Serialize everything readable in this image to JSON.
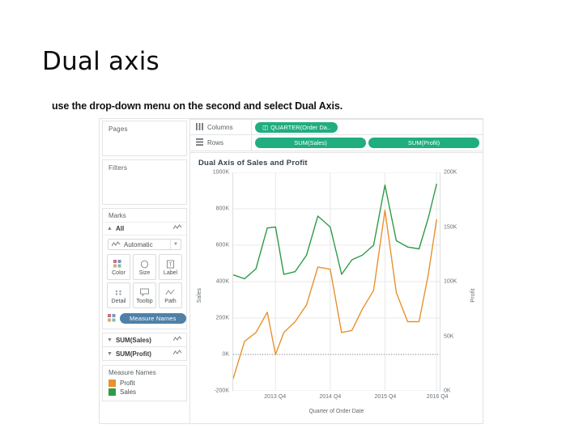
{
  "slide": {
    "title": "Dual axis",
    "subtitle_prefix": "use the drop-down menu on the second and select ",
    "subtitle_emphasis": "Dual Axis",
    "subtitle_suffix": "."
  },
  "colors": {
    "pill_green": "#20ad7f",
    "measure_pill_blue": "#4f81a8",
    "sales_line": "#2e9b46",
    "profit_line": "#e8912e",
    "panel_border": "#e4e4e4"
  },
  "shelves": {
    "pages_label": "Pages",
    "filters_label": "Filters",
    "columns_label": "Columns",
    "rows_label": "Rows",
    "columns_pills": [
      "QUARTER(Order Da.."
    ],
    "rows_pills": [
      "SUM(Sales)",
      "SUM(Profit)"
    ]
  },
  "marks": {
    "header": "Marks",
    "all_label": "All",
    "mark_type": "Automatic",
    "buttons": [
      {
        "label": "Color",
        "icon": "color-icon"
      },
      {
        "label": "Size",
        "icon": "size-icon"
      },
      {
        "label": "Label",
        "icon": "label-icon"
      },
      {
        "label": "Detail",
        "icon": "detail-icon"
      },
      {
        "label": "Tooltip",
        "icon": "tooltip-icon"
      },
      {
        "label": "Path",
        "icon": "path-icon"
      }
    ],
    "measure_names_pill": "Measure Names",
    "measure_cards": [
      "SUM(Sales)",
      "SUM(Profit)"
    ]
  },
  "legend": {
    "title": "Measure Names",
    "items": [
      {
        "name": "Profit",
        "color": "#e8912e"
      },
      {
        "name": "Sales",
        "color": "#2e9b46"
      }
    ]
  },
  "chart_data": {
    "type": "line",
    "title": "Dual Axis of Sales and Profit",
    "xlabel": "Quarter of Order Date",
    "grid": true,
    "legend_position": "left-panel",
    "x_tick_labels": [
      "2013 Q4",
      "2014 Q4",
      "2015 Q4",
      "2016 Q4"
    ],
    "x_tick_positions": [
      0.205,
      0.47,
      0.735,
      0.985
    ],
    "axes": [
      {
        "name": "Sales",
        "side": "left",
        "ylabel": "Sales",
        "tick_labels": [
          "1000K",
          "800K",
          "600K",
          "400K",
          "200K",
          "0K",
          "-200K"
        ],
        "ylim": [
          -200000,
          1000000
        ]
      },
      {
        "name": "Profit",
        "side": "right",
        "ylabel": "Profit",
        "tick_labels": [
          "200K",
          "150K",
          "100K",
          "50K",
          "0K"
        ],
        "ylim": [
          -50000,
          250000
        ]
      }
    ],
    "series": [
      {
        "name": "Sales",
        "color": "#2e9b46",
        "axis": "left",
        "x": [
          0.0,
          0.055,
          0.11,
          0.165,
          0.205,
          0.245,
          0.3,
          0.355,
          0.41,
          0.47,
          0.525,
          0.575,
          0.625,
          0.68,
          0.735,
          0.79,
          0.845,
          0.9,
          0.945,
          0.985
        ],
        "values": [
          437000,
          416000,
          470000,
          695000,
          700000,
          440000,
          455000,
          545000,
          760000,
          700000,
          440000,
          520000,
          545000,
          600000,
          930000,
          625000,
          590000,
          580000,
          750000,
          935000
        ]
      },
      {
        "name": "Profit",
        "color": "#e8912e",
        "axis": "right",
        "x": [
          0.0,
          0.055,
          0.11,
          0.165,
          0.205,
          0.245,
          0.3,
          0.355,
          0.41,
          0.47,
          0.525,
          0.575,
          0.625,
          0.68,
          0.735,
          0.79,
          0.845,
          0.9,
          0.945,
          0.985
        ],
        "values": [
          -33000,
          18000,
          30000,
          58000,
          0,
          30000,
          45000,
          68000,
          120000,
          117000,
          30000,
          33000,
          62000,
          88000,
          198000,
          85000,
          45000,
          45000,
          110000,
          185000
        ]
      }
    ]
  }
}
